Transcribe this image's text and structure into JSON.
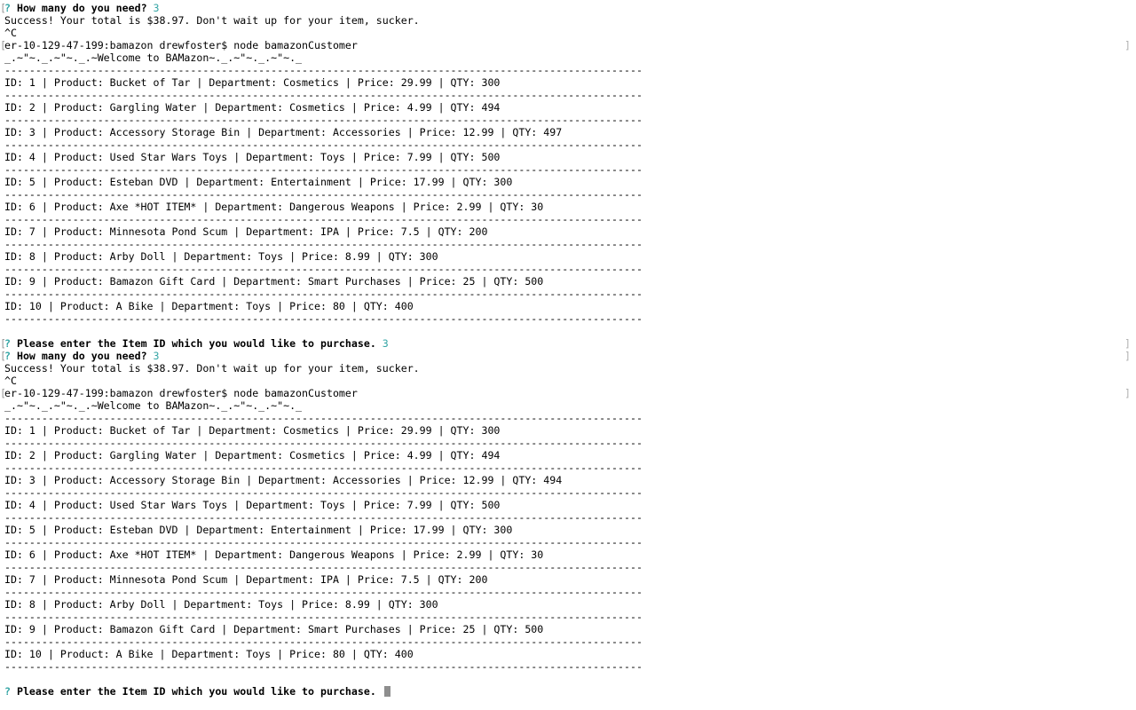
{
  "terminal": {
    "prompt_marker": "?",
    "qty_question": "How many do you need?",
    "qty_answer": "3",
    "success_message": "Success! Your total is $38.97. Don't wait up for your item, sucker.",
    "ctrl_c": "^C",
    "shell_prompt": "er-10-129-47-199:bamazon drewfoster$ node bamazonCustomer",
    "welcome_banner": "_.~\"~._.~\"~._.~Welcome to BAMazon~._.~\"~._.~\"~._",
    "separator": "-------------------------------------------------------------------------------------------------------",
    "purchase_question": "Please enter the Item ID which you would like to purchase.",
    "purchase_answer": "3",
    "table_rows_first": [
      "ID: 1 | Product: Bucket of Tar | Department: Cosmetics | Price: 29.99 | QTY: 300",
      "ID: 2 | Product: Gargling Water | Department: Cosmetics | Price: 4.99 | QTY: 494",
      "ID: 3 | Product: Accessory Storage Bin | Department: Accessories | Price: 12.99 | QTY: 497",
      "ID: 4 | Product: Used Star Wars Toys | Department: Toys | Price: 7.99 | QTY: 500",
      "ID: 5 | Product: Esteban DVD | Department: Entertainment | Price: 17.99 | QTY: 300",
      "ID: 6 | Product: Axe *HOT ITEM* | Department: Dangerous Weapons | Price: 2.99 | QTY: 30",
      "ID: 7 | Product: Minnesota Pond Scum | Department: IPA | Price: 7.5 | QTY: 200",
      "ID: 8 | Product: Arby Doll | Department: Toys | Price: 8.99 | QTY: 300",
      "ID: 9 | Product: Bamazon Gift Card | Department: Smart Purchases | Price: 25 | QTY: 500",
      "ID: 10 | Product: A Bike | Department: Toys | Price: 80 | QTY: 400"
    ],
    "table_rows_second": [
      "ID: 1 | Product: Bucket of Tar | Department: Cosmetics | Price: 29.99 | QTY: 300",
      "ID: 2 | Product: Gargling Water | Department: Cosmetics | Price: 4.99 | QTY: 494",
      "ID: 3 | Product: Accessory Storage Bin | Department: Accessories | Price: 12.99 | QTY: 494",
      "ID: 4 | Product: Used Star Wars Toys | Department: Toys | Price: 7.99 | QTY: 500",
      "ID: 5 | Product: Esteban DVD | Department: Entertainment | Price: 17.99 | QTY: 300",
      "ID: 6 | Product: Axe *HOT ITEM* | Department: Dangerous Weapons | Price: 2.99 | QTY: 30",
      "ID: 7 | Product: Minnesota Pond Scum | Department: IPA | Price: 7.5 | QTY: 200",
      "ID: 8 | Product: Arby Doll | Department: Toys | Price: 8.99 | QTY: 300",
      "ID: 9 | Product: Bamazon Gift Card | Department: Smart Purchases | Price: 25 | QTY: 500",
      "ID: 10 | Product: A Bike | Department: Toys | Price: 80 | QTY: 400"
    ],
    "colors": {
      "background": "#ffffff",
      "text": "#000000",
      "prompt_accent": "#35a5a5",
      "cursor": "#8e8e8e"
    }
  }
}
